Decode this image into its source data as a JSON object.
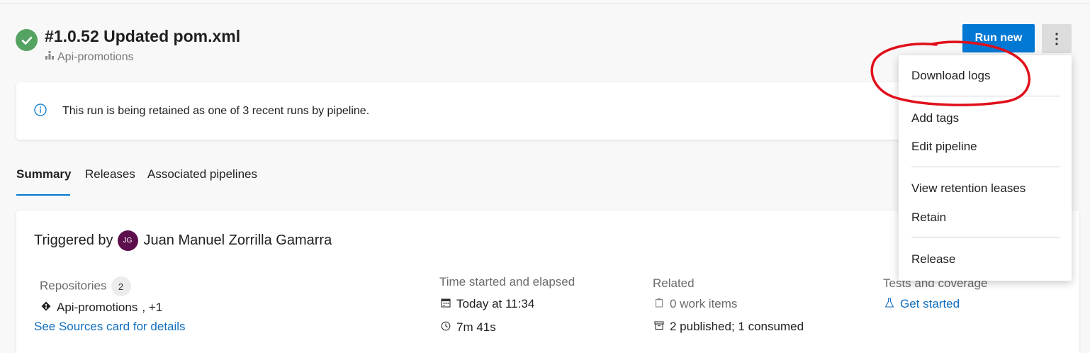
{
  "run": {
    "title": "#1.0.52 Updated pom.xml",
    "pipeline": "Api-promotions",
    "status": "succeeded"
  },
  "actions": {
    "run_new_label": "Run new"
  },
  "banner": {
    "text": "This run is being retained as one of 3 recent runs by pipeline."
  },
  "tabs": [
    {
      "label": "Summary",
      "active": true
    },
    {
      "label": "Releases",
      "active": false
    },
    {
      "label": "Associated pipelines",
      "active": false
    }
  ],
  "summary": {
    "triggered_prefix": "Triggered by",
    "avatar_initials": "JG",
    "triggered_user": "Juan Manuel Zorrilla Gamarra",
    "repositories": {
      "label": "Repositories",
      "count": "2",
      "repo_name": "Api-promotions",
      "more": ", +1",
      "details_link": "See Sources card for details"
    },
    "time": {
      "label": "Time started and elapsed",
      "started": "Today at 11:34",
      "elapsed": "7m 41s"
    },
    "related": {
      "label": "Related",
      "work_items": "0 work items",
      "artifacts": "2 published; 1 consumed"
    },
    "tests": {
      "label": "Tests and coverage",
      "link": "Get started"
    }
  },
  "menu": {
    "items": [
      {
        "label": "Download logs"
      },
      {
        "label": "Add tags"
      },
      {
        "label": "Edit pipeline"
      },
      {
        "label": "View retention leases"
      },
      {
        "label": "Retain"
      },
      {
        "label": "Release"
      }
    ]
  },
  "colors": {
    "accent": "#0078d4",
    "success": "#55a362",
    "annotation": "#e0101a"
  }
}
